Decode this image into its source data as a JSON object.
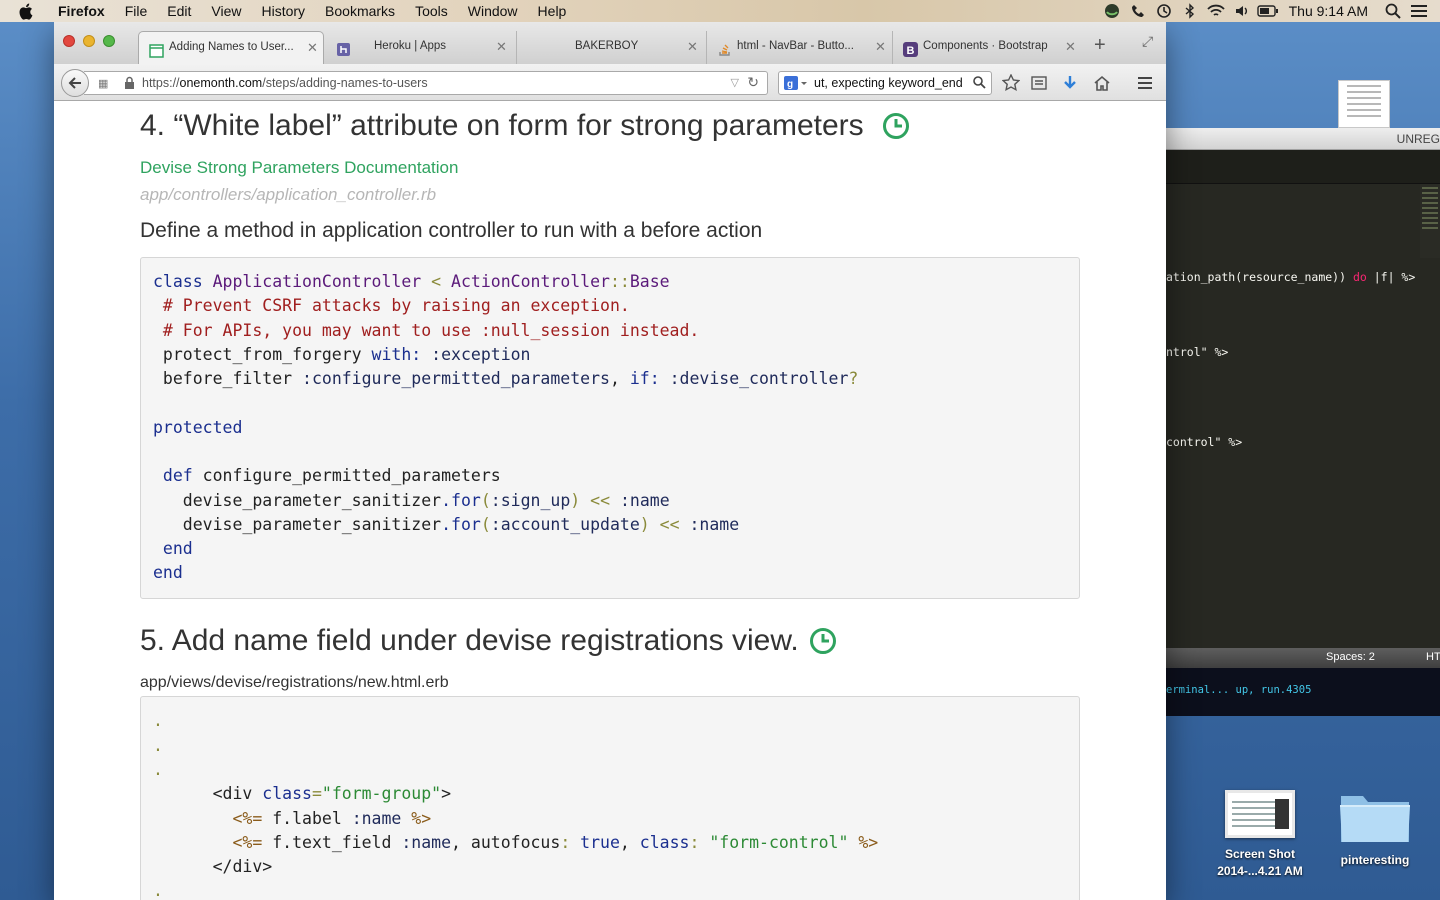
{
  "menubar": {
    "app": "Firefox",
    "items": [
      "File",
      "Edit",
      "View",
      "History",
      "Bookmarks",
      "Tools",
      "Window",
      "Help"
    ],
    "clock": "Thu 9:14 AM"
  },
  "browser": {
    "tabs": [
      {
        "label": "Adding Names to User...",
        "icon": "onemonth-favicon",
        "active": true
      },
      {
        "label": "Heroku | Apps",
        "icon": "heroku-favicon",
        "active": false
      },
      {
        "label": "BAKERBOY",
        "icon": "",
        "active": false
      },
      {
        "label": "html - NavBar - Butto...",
        "icon": "stackoverflow-favicon",
        "active": false
      },
      {
        "label": "Components · Bootstrap",
        "icon": "bootstrap-favicon",
        "active": false
      }
    ],
    "url_prefix": "https://",
    "url_host": "onemonth.com",
    "url_path": "/steps/adding-names-to-users",
    "search_value": "ut, expecting keyword_end"
  },
  "page": {
    "step4_title": "4. “White label” attribute on form for strong parameters",
    "doc_link": "Devise Strong Parameters Documentation",
    "file_path_1": "app/controllers/application_controller.rb",
    "description": "Define a method in application controller to run with a before action",
    "code_1": {
      "l1_kw": "class",
      "l1_cls": "ApplicationController",
      "l1_lt": "<",
      "l1_parent": "ActionController",
      "l1_sep": "::",
      "l1_base": "Base",
      "l2": " # Prevent CSRF attacks by raising an exception.",
      "l3": " # For APIs, you may want to use :null_session instead.",
      "l4_a": " protect_from_forgery ",
      "l4_b": "with:",
      "l4_c": " :exception",
      "l5_a": " before_filter ",
      "l5_b": ":configure_permitted_parameters",
      "l5_c": ", ",
      "l5_d": "if:",
      "l5_e": " :devise_controller",
      "l5_f": "?",
      "l7": "protected",
      "l9_kw": " def",
      "l9_name": " configure_permitted_parameters",
      "l10_a": "   devise_parameter_sanitizer",
      "l10_b": ".for",
      "l10_c": "(",
      "l10_d": ":sign_up",
      "l10_e": ")",
      "l10_f": " << ",
      "l10_g": ":name",
      "l11_a": "   devise_parameter_sanitizer",
      "l11_b": ".for",
      "l11_c": "(",
      "l11_d": ":account_update",
      "l11_e": ")",
      "l11_f": " << ",
      "l11_g": ":name",
      "l12": " end",
      "l13": "end"
    },
    "step5_title": "5. Add name field under devise registrations view.",
    "file_path_2": "app/views/devise/registrations/new.html.erb",
    "code_2": {
      "dot": ".",
      "l4_a": "      <div ",
      "l4_b": "class",
      "l4_c": "=",
      "l4_d": "\"form-group\"",
      "l4_e": ">",
      "l5_a": "        <%=",
      "l5_b": " f.label ",
      "l5_c": ":name",
      "l5_d": " %>",
      "l6_a": "        <%=",
      "l6_b": " f.text_field ",
      "l6_c": ":name",
      "l6_d": ", autofocus",
      "l6_e": ":",
      "l6_f": " true",
      "l6_g": ", ",
      "l6_h": "class",
      "l6_i": ":",
      "l6_j": " \"form-control\"",
      "l6_k": " %>",
      "l7": "      </div>"
    }
  },
  "editor": {
    "title": "UNREG",
    "line1_a": "ation_path(resource_name)) ",
    "line1_b": "do",
    "line1_c": " |f| %>",
    "line2": "ntrol\" %>",
    "line3": "control\" %>",
    "spaces": "Spaces: 2",
    "syntax": "HT",
    "terminal": "erminal... up, run.4305"
  },
  "desktop": {
    "screenshot_label_1": "Screen Shot",
    "screenshot_label_2": "2014-...4.21 AM",
    "folder_label": "pinteresting"
  },
  "colors": {
    "link_green": "#2fa35f",
    "code_bg": "#f5f5f5",
    "editor_bg": "#272822"
  }
}
